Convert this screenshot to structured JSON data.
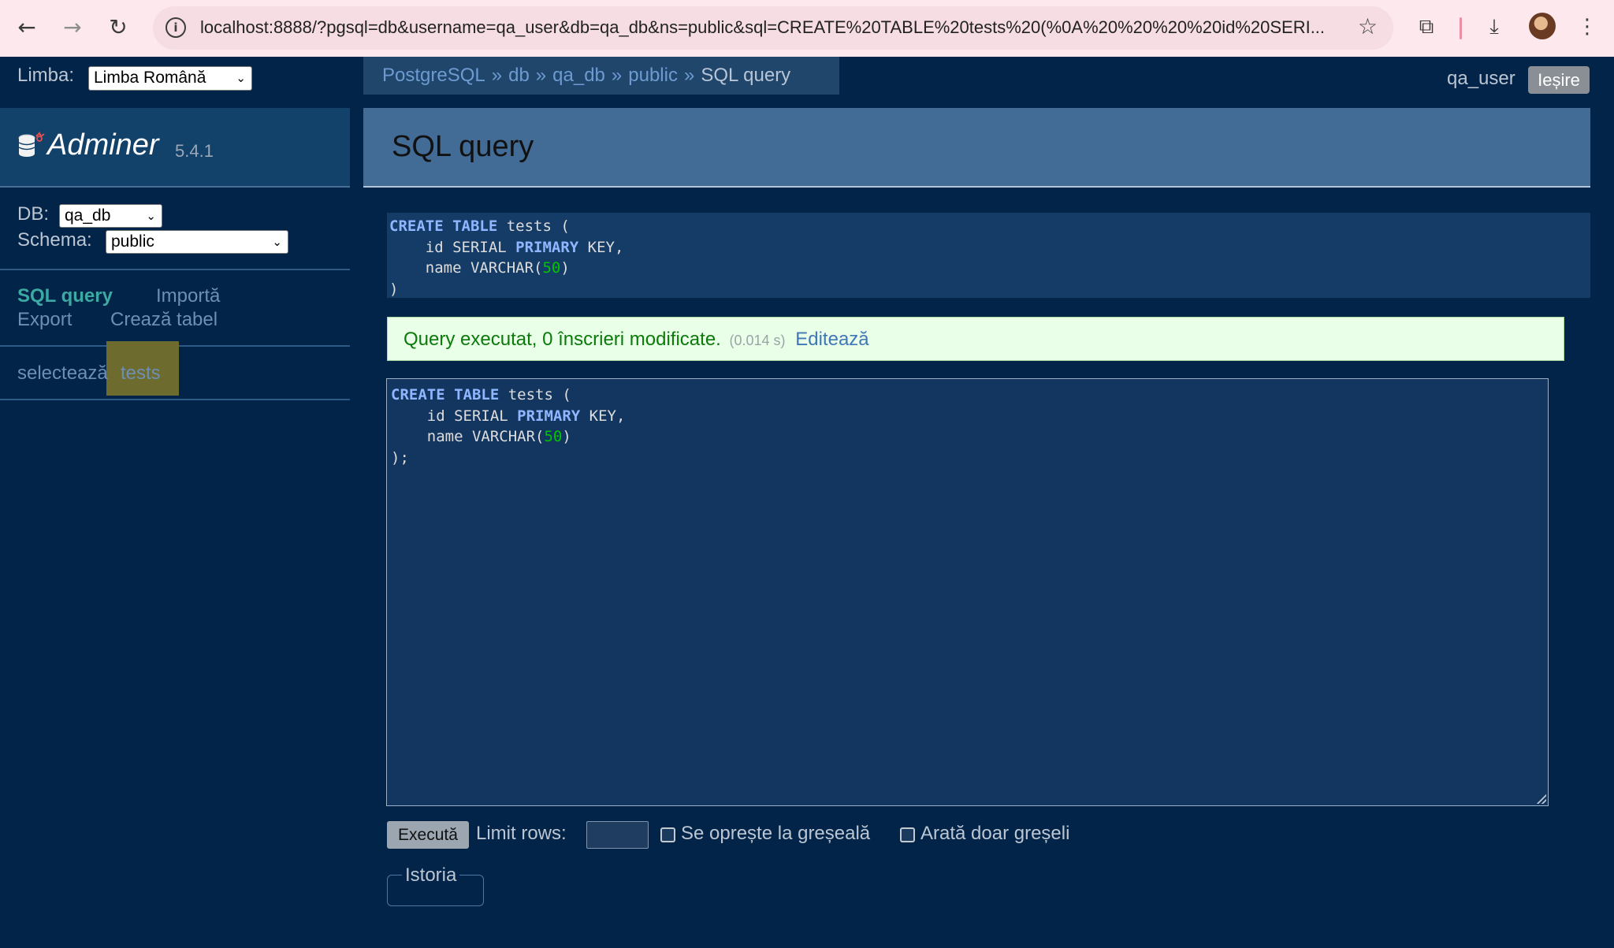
{
  "browser": {
    "url": "localhost:8888/?pgsql=db&username=qa_user&db=qa_db&ns=public&sql=CREATE%20TABLE%20tests%20(%0A%20%20%20%20id%20SERI..."
  },
  "top": {
    "language_label": "Limba:",
    "language_value": "Limba Română",
    "breadcrumb": [
      "PostgreSQL",
      "db",
      "qa_db",
      "public"
    ],
    "breadcrumb_current": "SQL query",
    "breadcrumb_separator": "»",
    "user": "qa_user",
    "logout_label": "Ieșire"
  },
  "sidebar": {
    "app_name": "Adminer",
    "version": "5.4.1",
    "db_label": "DB:",
    "db_value": "qa_db",
    "schema_label": "Schema:",
    "schema_value": "public",
    "links": {
      "sql_query": "SQL query",
      "import": "Importă",
      "export": "Export",
      "create_table": "Crează tabel"
    },
    "table_select_label": "selectează",
    "table_name": "tests"
  },
  "main": {
    "title": "SQL query",
    "executed_sql": {
      "kw1": "CREATE",
      "kw2": "TABLE",
      "line1_rest": " tests (",
      "line2_pre": "    id SERIAL ",
      "line2_kw": "PRIMARY",
      "line2_post": " KEY,",
      "line3_pre": "    name VARCHAR(",
      "line3_num": "50",
      "line3_post": ")",
      "line4": ")"
    },
    "message": {
      "text": "Query executat, 0 înscrieri modificate.",
      "time": "(0.014 s)",
      "edit_label": "Editează"
    },
    "editor": {
      "kw1": "CREATE",
      "kw2": "TABLE",
      "line1_rest": " tests (",
      "line2_pre": "    id SERIAL ",
      "line2_kw": "PRIMARY",
      "line2_post": " KEY,",
      "line3_pre": "    name VARCHAR(",
      "line3_num": "50",
      "line3_post": ")",
      "line4": ");"
    },
    "execute_label": "Execută",
    "limit_label": "Limit rows:",
    "limit_value": "",
    "stop_on_error_label": "Se oprește la greșeală",
    "stop_on_error_checked": false,
    "only_errors_label": "Arată doar greșeli",
    "only_errors_checked": false,
    "history_label": "Istoria"
  },
  "colors": {
    "page_background": "#022448",
    "link": "#6d8fb4",
    "active_link": "#3ca9a3",
    "sql_keyword": "#8fb6ff",
    "sql_number": "#00c400",
    "success_text": "#0a7a0a",
    "success_background": "#eaffe8"
  }
}
